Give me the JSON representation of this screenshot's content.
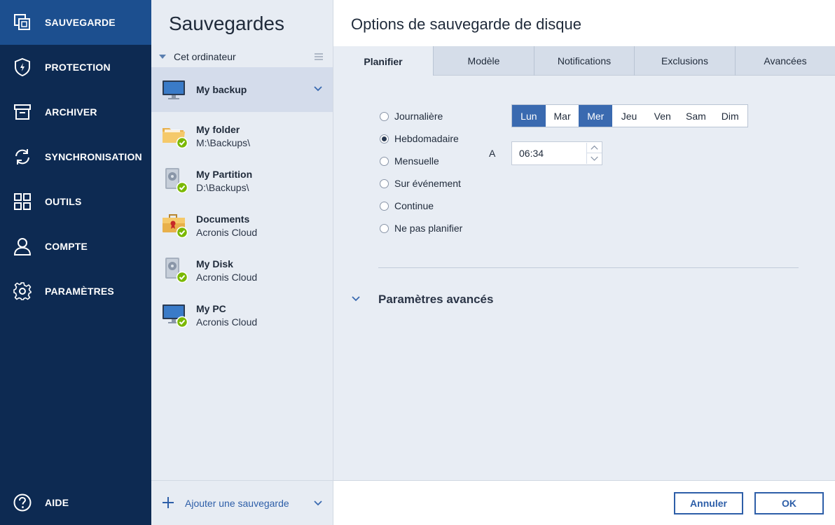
{
  "nav": {
    "items": [
      {
        "label": "SAUVEGARDE",
        "icon": "backup-copies-icon",
        "active": true
      },
      {
        "label": "PROTECTION",
        "icon": "shield-bolt-icon"
      },
      {
        "label": "ARCHIVER",
        "icon": "archive-box-icon"
      },
      {
        "label": "SYNCHRONISATION",
        "icon": "sync-arrows-icon"
      },
      {
        "label": "OUTILS",
        "icon": "tools-grid-icon"
      },
      {
        "label": "COMPTE",
        "icon": "user-icon"
      },
      {
        "label": "PARAMÈTRES",
        "icon": "gear-icon"
      }
    ],
    "help": {
      "label": "AIDE",
      "icon": "help-circle-icon"
    }
  },
  "list": {
    "title": "Sauvegardes",
    "group": "Cet ordinateur",
    "items": [
      {
        "name": "My backup",
        "dest": "",
        "icon": "monitor-icon",
        "selected": true
      },
      {
        "name": "My folder",
        "dest": "M:\\Backups\\",
        "icon": "folder-icon",
        "status": "ok"
      },
      {
        "name": "My Partition",
        "dest": "D:\\Backups\\",
        "icon": "hard-drive-icon",
        "status": "ok"
      },
      {
        "name": "Documents",
        "dest": "Acronis Cloud",
        "icon": "briefcase-icon",
        "status": "ok"
      },
      {
        "name": "My Disk",
        "dest": "Acronis Cloud",
        "icon": "hard-drive-icon",
        "status": "ok"
      },
      {
        "name": "My PC",
        "dest": "Acronis Cloud",
        "icon": "monitor-icon",
        "status": "ok"
      }
    ],
    "add_label": "Ajouter une sauvegarde"
  },
  "panel": {
    "title": "Options de sauvegarde de disque",
    "tabs": [
      "Planifier",
      "Modèle",
      "Notifications",
      "Exclusions",
      "Avancées"
    ],
    "active_tab": "Planifier",
    "schedule_options": [
      "Journalière",
      "Hebdomadaire",
      "Mensuelle",
      "Sur événement",
      "Continue",
      "Ne pas planifier"
    ],
    "selected_option": "Hebdomadaire",
    "days": [
      {
        "label": "Lun",
        "on": true
      },
      {
        "label": "Mar",
        "on": false
      },
      {
        "label": "Mer",
        "on": true
      },
      {
        "label": "Jeu",
        "on": false
      },
      {
        "label": "Ven",
        "on": false
      },
      {
        "label": "Sam",
        "on": false
      },
      {
        "label": "Dim",
        "on": false
      }
    ],
    "time_label": "A",
    "time_value": "06:34",
    "advanced_title": "Paramètres avancés",
    "cancel_label": "Annuler",
    "ok_label": "OK"
  },
  "colors": {
    "nav_bg": "#0d2a52",
    "nav_active": "#1c4f8f",
    "accent": "#2d5ea8",
    "day_on": "#3a6ab0",
    "ok_green": "#7ab800"
  }
}
